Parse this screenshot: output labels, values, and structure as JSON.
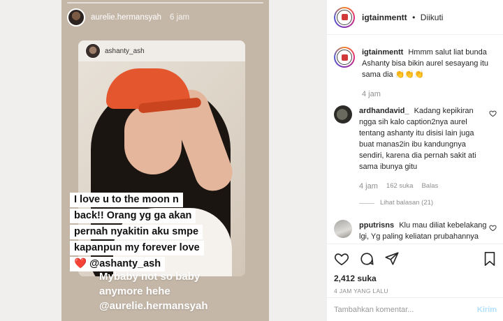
{
  "story": {
    "username": "aurelie.hermansyah",
    "time": "6 jam",
    "reshared_username": "ashanty_ash",
    "caption_lines": [
      "I love u to the moon n",
      "back!! Orang yg ga akan",
      "pernah nyakitin aku smpe",
      "kapanpun my forever love",
      "❤️ @ashanty_ash"
    ],
    "tagline_lines": [
      "Mybaby not so baby",
      "anymore hehe",
      "@aurelie.hermansyah"
    ]
  },
  "post": {
    "username": "igtainmentt",
    "separator": "•",
    "follow_status": "Diikuti"
  },
  "comments": [
    {
      "user": "igtainmentt",
      "text": "Hmmm salut liat bunda Ashanty bisa bikin aurel sesayang itu sama dia 👏👏👏",
      "time": "4 jam"
    },
    {
      "user": "ardhandavid_",
      "text": "Kadang kepikiran ngga sih kalo caption2nya aurel tentang ashanty itu disisi lain juga buat manas2in ibu kandungnya sendiri, karena dia pernah sakit ati sama ibunya gitu",
      "time": "4 jam",
      "likes": "162 suka",
      "reply": "Balas",
      "view_replies": "Lihat balasan (21)"
    },
    {
      "user": "pputrisns",
      "text": "Klu mau diliat kebelakang lgi, Yg paling keliatan prubahannya sejak ada ash itu jiel. Jiel bisa peluk2 sayang sayangan ama ash sampe udh rebesar skrng"
    }
  ],
  "footer": {
    "likes": "2,412 suka",
    "time": "4 JAM YANG LALU",
    "comment_placeholder": "Tambahkan komentar...",
    "post_label": "Kirim"
  },
  "icons": {
    "like": "heart-icon",
    "comment": "comment-icon",
    "share": "share-icon",
    "save": "bookmark-icon"
  },
  "colors": {
    "story_bg": "#c4b7a8",
    "cap": "#e4572e",
    "post_button": "#b2dffc"
  }
}
